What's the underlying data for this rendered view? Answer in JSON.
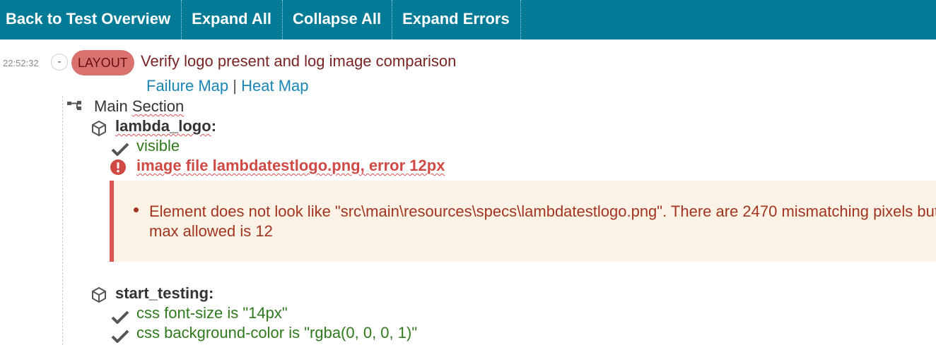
{
  "toolbar": {
    "back_label": "Back to Test Overview",
    "expand_all_label": "Expand All",
    "collapse_all_label": "Collapse All",
    "expand_errors_label": "Expand Errors"
  },
  "report": {
    "time": "22:52:32",
    "collapse_symbol": "-",
    "badge": "LAYOUT",
    "title": "Verify logo present and log image comparison",
    "failure_map_label": "Failure Map",
    "separator": "|",
    "heat_map_label": "Heat Map"
  },
  "section": {
    "title": "Main Section",
    "objects": [
      {
        "name": "lambda_logo",
        "suffix": ":",
        "specs": [
          {
            "status": "pass",
            "text": "visible"
          },
          {
            "status": "fail",
            "text": "image file lambdatestlogo.png, error 12px"
          }
        ],
        "error_message": "Element does not look like \"src\\main\\resources\\specs\\lambdatestlogo.png\". There are 2470 mismatching pixels but max allowed is 12"
      },
      {
        "name": "start_testing",
        "suffix": ":",
        "specs": [
          {
            "status": "pass",
            "text": "css font-size is \"14px\""
          },
          {
            "status": "pass",
            "text": "css background-color is \"rgba(0, 0, 0, 1)\""
          }
        ]
      }
    ]
  },
  "colors": {
    "toolbar_bg": "#037a96",
    "badge_bg": "#d9726f",
    "pass_text": "#2f7a1c",
    "fail_text": "#cf4a45",
    "link": "#1a86b6",
    "error_box_bg": "#fcf3e6",
    "error_border": "#d9534f"
  },
  "icons": {
    "section": "section-tree-icon",
    "object": "cube-icon",
    "pass": "checkmark-icon",
    "fail": "exclamation-circle-icon"
  }
}
